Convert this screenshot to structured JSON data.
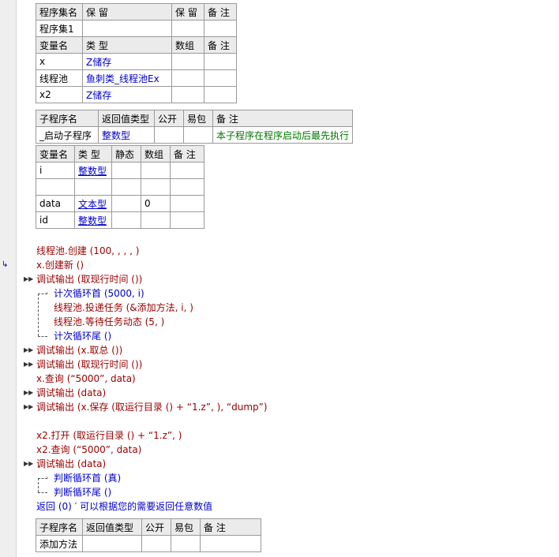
{
  "assembly_table": {
    "header": [
      "程序集名",
      "保 留",
      "保 留",
      "备 注"
    ],
    "row": [
      "程序集1",
      "",
      "",
      ""
    ]
  },
  "assembly_vars": {
    "header": [
      "变量名",
      "类 型",
      "数组",
      "备 注"
    ],
    "rows": [
      [
        "x",
        "Z储存",
        "",
        ""
      ],
      [
        "线程池",
        "鱼刺类_线程池Ex",
        "",
        ""
      ],
      [
        "x2",
        "Z储存",
        "",
        ""
      ]
    ]
  },
  "sub_table": {
    "header": [
      "子程序名",
      "返回值类型",
      "公开",
      "易包",
      "备 注"
    ],
    "row": [
      "_启动子程序",
      "整数型",
      "",
      "",
      "本子程序在程序启动后最先执行"
    ]
  },
  "local_vars": {
    "header": [
      "变量名",
      "类 型",
      "静态",
      "数组",
      "备 注"
    ],
    "rows": [
      [
        "i",
        "整数型",
        "",
        "",
        ""
      ],
      [
        "",
        "",
        "",
        "",
        ""
      ],
      [
        "data",
        "文本型",
        "",
        "0",
        ""
      ],
      [
        "id",
        "整数型",
        "",
        "",
        ""
      ]
    ]
  },
  "code": [
    "线程池.创建 (100, , , , )",
    "x.创建新 ()",
    "调试输出 (取现行时间 ())",
    "计次循环首 (5000, i)",
    "线程池.投递任务 (&添加方法, i, )",
    "线程池.等待任务动态 (5, )",
    "计次循环尾 ()",
    "调试输出 (x.取总 ())",
    "调试输出 (取现行时间 ())",
    "x.查询 (“5000”, data)",
    "调试输出 (data)",
    "调试输出 (x.保存 (取运行目录 () + “1.z”, ), “dump”)",
    "x2.打开 (取运行目录 () + “1.z”, )",
    "x2.查询 (“5000”, data)",
    "调试输出 (data)",
    "判断循环首 (真)",
    "判断循环尾 ()",
    "返回 (0)  ′ 可以根据您的需要返回任意数值"
  ],
  "sub2_table": {
    "header": [
      "子程序名",
      "返回值类型",
      "公开",
      "易包",
      "备 注"
    ],
    "row": [
      "添加方法",
      "",
      "",
      "",
      ""
    ]
  }
}
